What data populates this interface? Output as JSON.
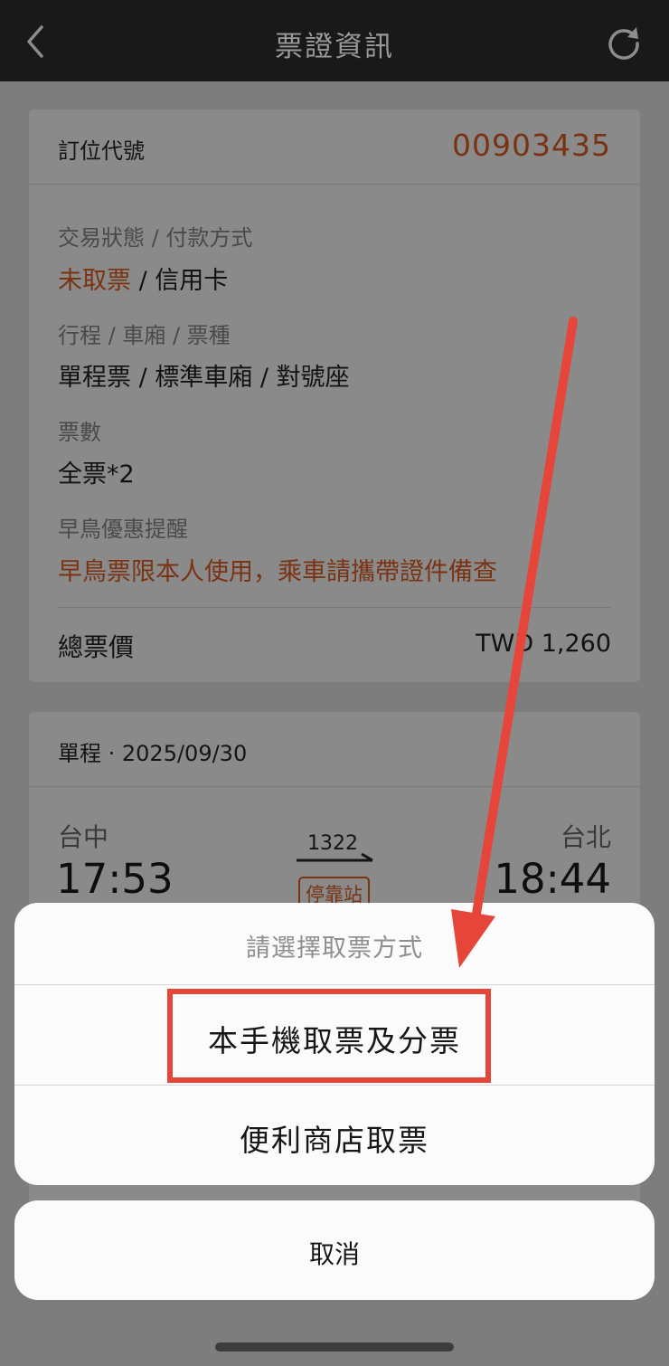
{
  "nav": {
    "title": "票證資訊",
    "back_icon": "chevron-left-icon",
    "refresh_icon": "refresh-icon"
  },
  "booking": {
    "code_label": "訂位代號",
    "code_value": "00903435",
    "status_label": "交易狀態 / 付款方式",
    "status_value": "未取票",
    "status_sep": " / ",
    "payment_value": "信用卡",
    "trip_label": "行程 / 車廂 / 票種",
    "trip_value": "單程票 / 標準車廂 / 對號座",
    "count_label": "票數",
    "count_value": "全票*2",
    "early_label": "早鳥優惠提醒",
    "early_value": "早鳥票限本人使用，乘車請攜帶證件備查",
    "total_label": "總票價",
    "total_value": "TWD 1,260"
  },
  "trip": {
    "header": "單程 · 2025/09/30",
    "from_station": "台中",
    "from_time": "17:53",
    "to_station": "台北",
    "to_time": "18:44",
    "train_no": "1322",
    "stop_badge": "停靠站"
  },
  "sheet": {
    "title": "請選擇取票方式",
    "option_phone": "本手機取票及分票",
    "option_store": "便利商店取票",
    "cancel": "取消"
  },
  "colors": {
    "accent": "#7a3312",
    "annotation": "#e6453a",
    "navbar": "#191919"
  }
}
